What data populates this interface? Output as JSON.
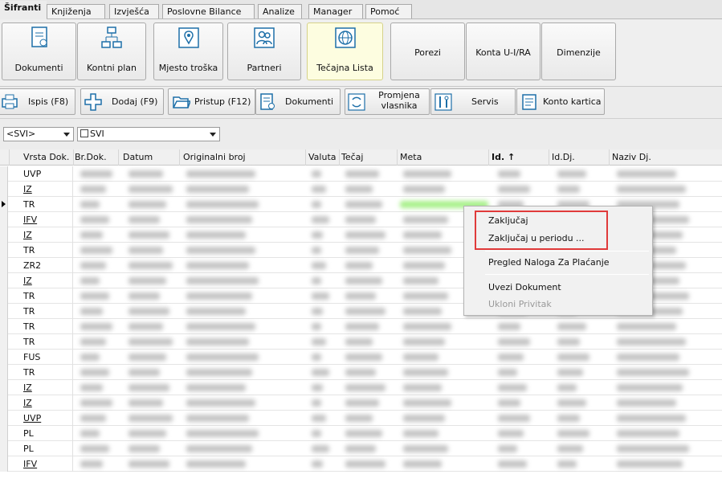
{
  "menu_tabs": [
    "Šifranti",
    "Knjiženja",
    "Izvješća",
    "Poslovne Bilance",
    "Analize",
    "Manager",
    "Pomoć"
  ],
  "ribbon": {
    "dokumenti": "Dokumenti",
    "kontni_plan": "Kontni plan",
    "mjesto_troska": "Mjesto troška",
    "partneri": "Partneri",
    "tecajna_lista": "Tečajna Lista",
    "porezi": "Porezi",
    "konta": "Konta U-I/RA",
    "dimenzije": "Dimenzije"
  },
  "toolbar": {
    "ispis": "Ispis (F8)",
    "dodaj": "Dodaj (F9)",
    "pristup": "Pristup (F12)",
    "dokumenti": "Dokumenti",
    "promjena_1": "Promjena",
    "promjena_2": "vlasnika",
    "servis": "Servis",
    "konto_kartica": "Konto kartica"
  },
  "filters": {
    "combo1": "<SVI>",
    "combo2": "SVI"
  },
  "columns": [
    "Vrsta Dok.",
    "Br.Dok.",
    "Datum",
    "Originalni broj",
    "Valuta",
    "Tečaj",
    "Meta",
    "Id. ↑",
    "Id.Dj.",
    "Naziv Dj."
  ],
  "rows": [
    "UVP",
    "IZ",
    "TR",
    "IFV",
    "IZ",
    "TR",
    "ZR2",
    "IZ",
    "TR",
    "TR",
    "TR",
    "TR",
    "FUS",
    "TR",
    "IZ",
    "IZ",
    "UVP",
    "PL",
    "PL",
    "IFV"
  ],
  "underlined_rows": [
    1,
    3,
    4,
    7,
    14,
    15,
    16,
    19
  ],
  "selected_row": 2,
  "context_menu": {
    "zakljucaj": "Zaključaj",
    "zakljucaj_period": "Zaključaj u periodu ...",
    "pregled": "Pregled Naloga Za Plaćanje",
    "uvezi": "Uvezi Dokument",
    "ukloni": "Ukloni Privitak"
  },
  "colors": {
    "highlight_box": "#e03a3a",
    "selected_meta": "#a8f08a"
  }
}
